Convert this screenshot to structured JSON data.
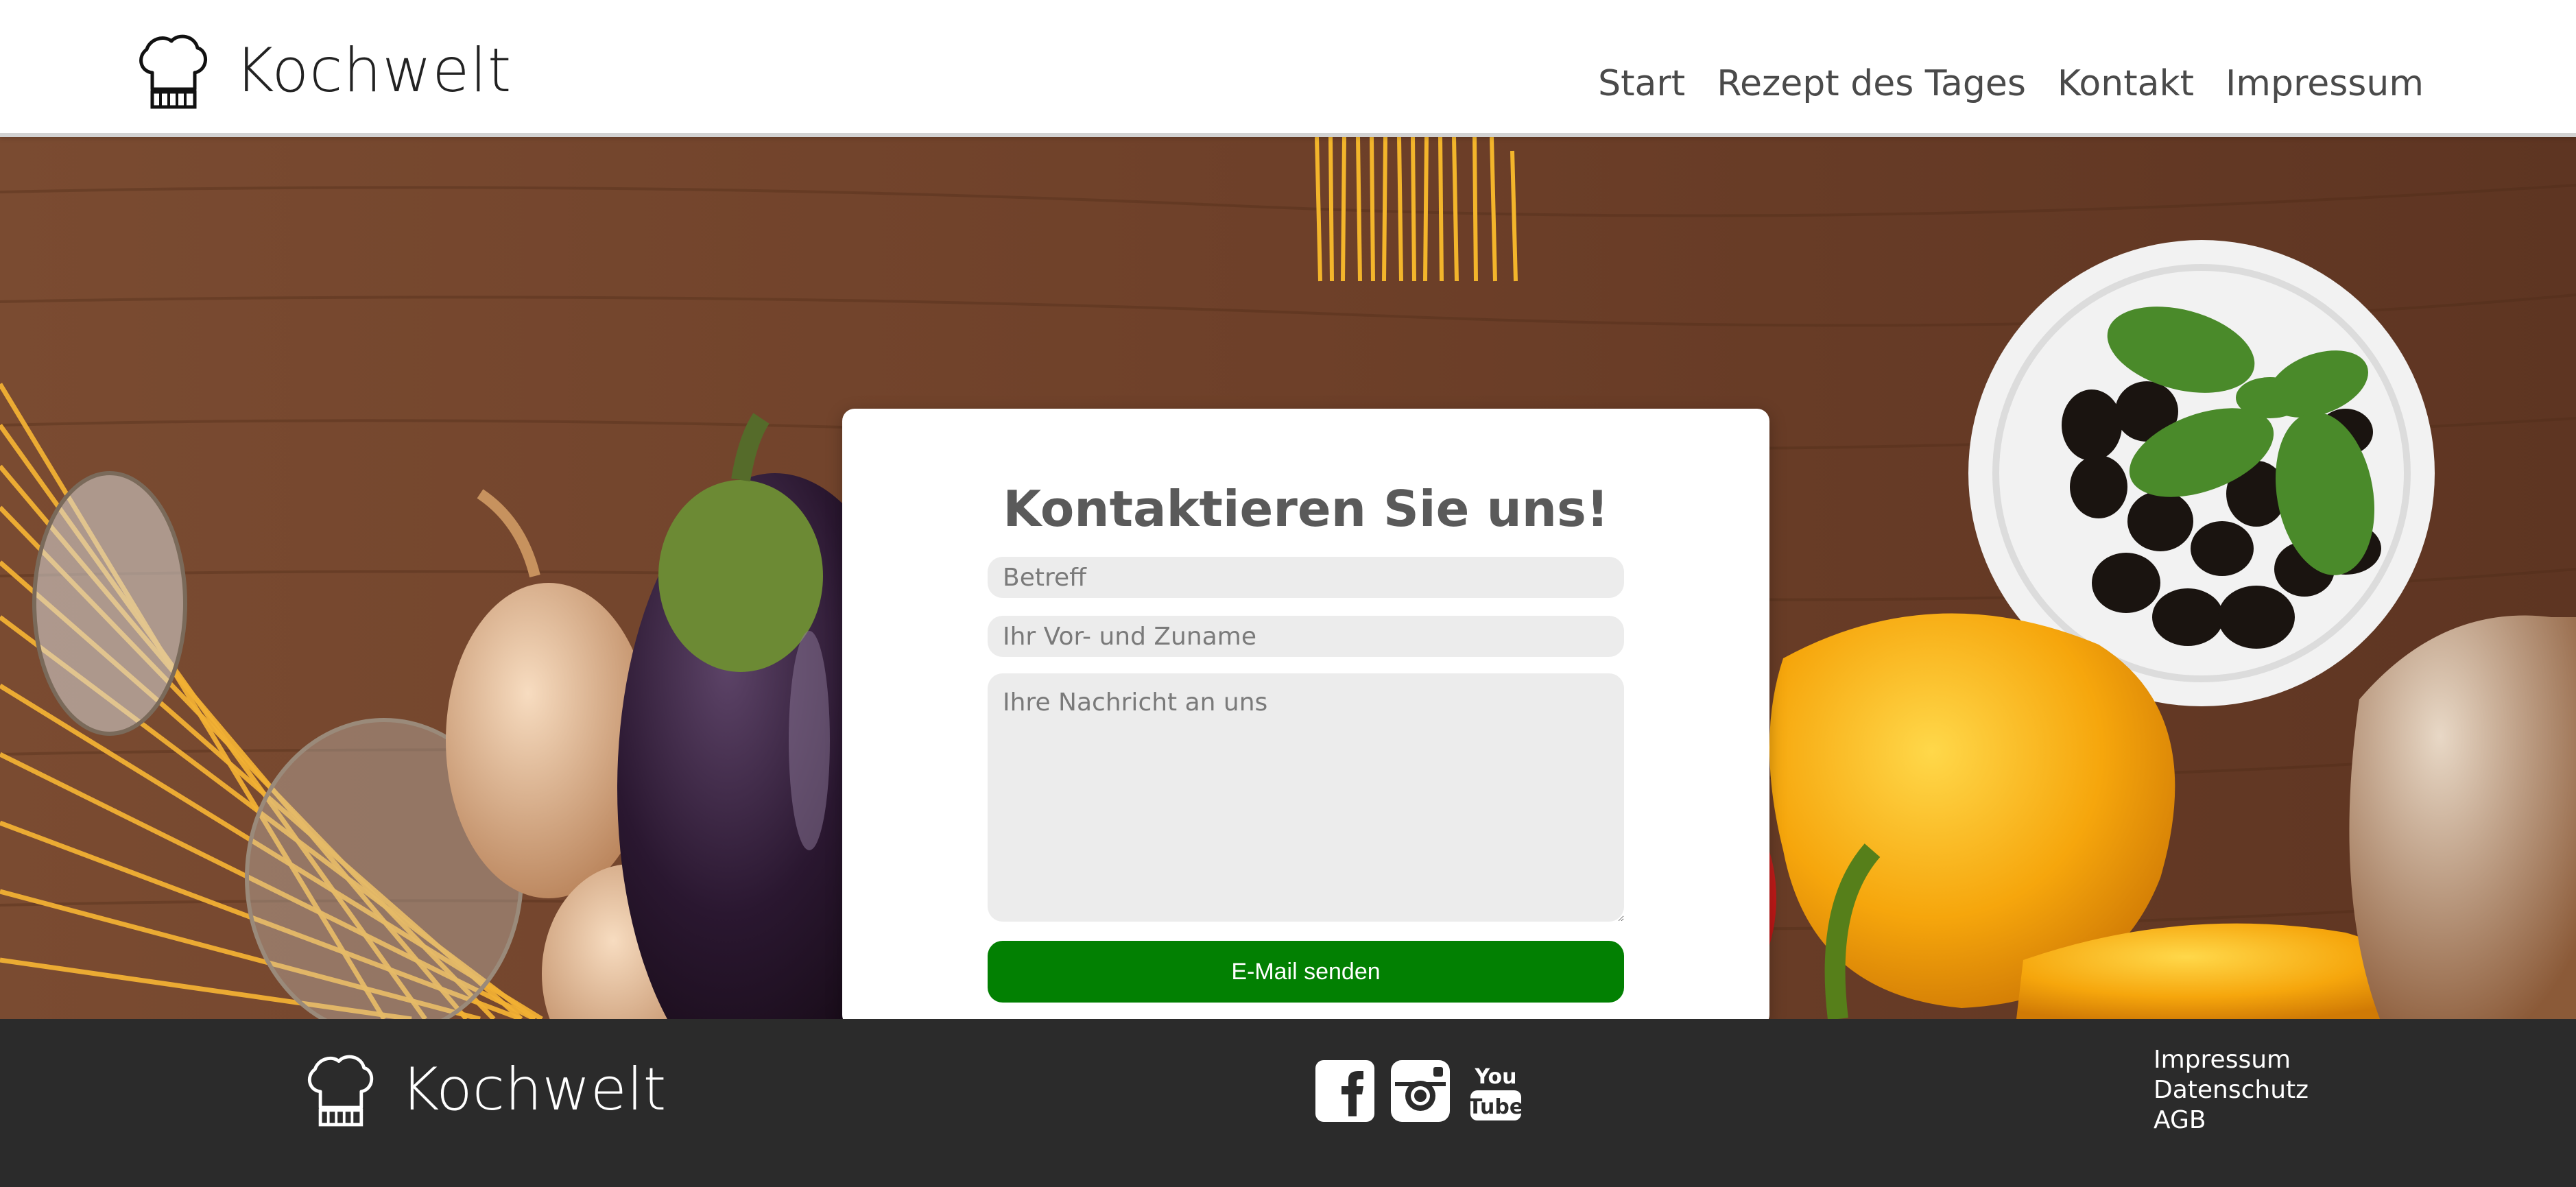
{
  "header": {
    "brand_name": "Kochwelt",
    "nav": [
      {
        "label": "Start"
      },
      {
        "label": "Rezept des Tages"
      },
      {
        "label": "Kontakt"
      },
      {
        "label": "Impressum"
      }
    ]
  },
  "contact": {
    "title": "Kontaktieren Sie uns!",
    "subject_placeholder": "Betreff",
    "name_placeholder": "Ihr Vor- und Zuname",
    "message_placeholder": "Ihre Nachricht an uns",
    "send_label": "E-Mail senden"
  },
  "footer": {
    "brand_name": "Kochwelt",
    "social": [
      {
        "icon": "facebook-icon"
      },
      {
        "icon": "instagram-icon"
      },
      {
        "icon": "youtube-icon"
      }
    ],
    "links": [
      {
        "label": "Impressum"
      },
      {
        "label": "Datenschutz"
      },
      {
        "label": "AGB"
      }
    ]
  },
  "colors": {
    "accent_green": "#028002",
    "footer_bg": "#2b2b2b",
    "field_bg": "#ececec",
    "title_gray": "#5a5a5a"
  }
}
